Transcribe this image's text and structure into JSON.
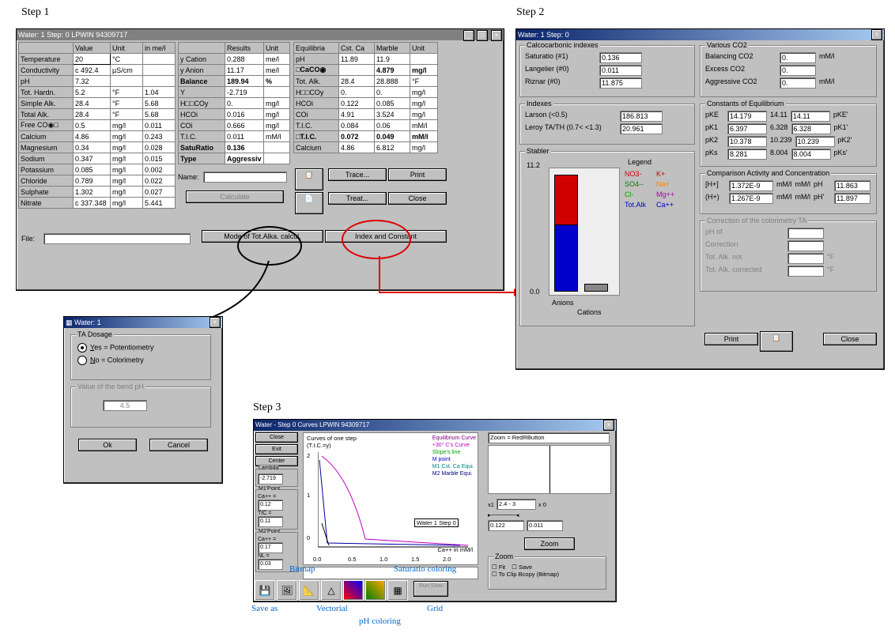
{
  "steps": {
    "s1": "Step 1",
    "s2": "Step 2",
    "s3": "Step 3"
  },
  "win1": {
    "title": "Water:  1 Step:  0        LPWIN 94309717",
    "hdr1": {
      "c1": "",
      "c2": "Value",
      "c3": "Unit",
      "c4": "in me/l"
    },
    "rows1": [
      {
        "n": "Temperature",
        "v": "20",
        "u": "°C",
        "m": ""
      },
      {
        "n": "Conductivity",
        "v": "c 492.4",
        "u": "µS/cm",
        "m": ""
      },
      {
        "n": "pH",
        "v": "7.32",
        "u": "",
        "m": ""
      },
      {
        "n": "Tot. Hardn.",
        "v": "5.2",
        "u": "°F",
        "m": "1.04"
      },
      {
        "n": "Simple Alk.",
        "v": "28.4",
        "u": "°F",
        "m": "5.68"
      },
      {
        "n": "Total Alk.",
        "v": "28.4",
        "u": "°F",
        "m": "5.68"
      },
      {
        "n": "Free CO◉□",
        "v": "0.5",
        "u": "mg/l",
        "m": "0.011"
      },
      {
        "n": "Calcium",
        "v": "4.86",
        "u": "mg/l",
        "m": "0.243"
      },
      {
        "n": "Magnesium",
        "v": "0.34",
        "u": "mg/l",
        "m": "0.028"
      },
      {
        "n": "Sodium",
        "v": "0.347",
        "u": "mg/l",
        "m": "0.015"
      },
      {
        "n": "Potassium",
        "v": "0.085",
        "u": "mg/l",
        "m": "0.002"
      },
      {
        "n": "Chloride",
        "v": "0.789",
        "u": "mg/l",
        "m": "0.022"
      },
      {
        "n": "Sulphate",
        "v": "1.302",
        "u": "mg/l",
        "m": "0.027"
      },
      {
        "n": "Nitrate",
        "v": "c 337.348",
        "u": "mg/l",
        "m": "5.441"
      }
    ],
    "hdr2": {
      "c1": "",
      "c2": "Results",
      "c3": "Unit"
    },
    "rows2": [
      {
        "n": "y Cation",
        "v": "0.288",
        "u": "me/l",
        "b": false
      },
      {
        "n": "y Anion",
        "v": "11.17",
        "u": "me/l",
        "b": false
      },
      {
        "n": "Balance",
        "v": "189.94",
        "u": "%",
        "b": true
      },
      {
        "n": "Y",
        "v": "-2.719",
        "u": "",
        "b": false
      },
      {
        "n": "H□□COy",
        "v": "0.",
        "u": "mg/l",
        "b": false
      },
      {
        "n": "HCOi",
        "v": "0.016",
        "u": "mg/l",
        "b": false
      },
      {
        "n": "COi",
        "v": "0.666",
        "u": "mg/l",
        "b": false
      },
      {
        "n": "T.I.C.",
        "v": "0.011",
        "u": "mM/l",
        "b": false
      },
      {
        "n": "SatuRatio",
        "v": "0.136",
        "u": "",
        "b": true
      },
      {
        "n": "Type",
        "v": "Aggressiv",
        "u": "",
        "b": true
      }
    ],
    "hdr3": {
      "c1": "Equilibria",
      "c2": "Cst. Ca",
      "c3": "Marble",
      "c4": "Unit"
    },
    "rows3": [
      {
        "n": "pH",
        "a": "11.89",
        "b": "11.9",
        "u": "",
        "bold": false
      },
      {
        "n": "□CaCO◉",
        "a": "",
        "b": "4.879",
        "u": "mg/l",
        "bold": true
      },
      {
        "n": "Tot. Alk.",
        "a": "28.4",
        "b": "28.888",
        "u": "°F",
        "bold": false
      },
      {
        "n": "H□□COy",
        "a": "0.",
        "b": "0.",
        "u": "mg/l",
        "bold": false
      },
      {
        "n": "HCOi",
        "a": "0.122",
        "b": "0.085",
        "u": "mg/l",
        "bold": false
      },
      {
        "n": "COi",
        "a": "4.91",
        "b": "3.524",
        "u": "mg/l",
        "bold": false
      },
      {
        "n": "T.I.C.",
        "a": "0.084",
        "b": "0.06",
        "u": "mM/l",
        "bold": false
      },
      {
        "n": "□T.I.C.",
        "a": "0.072",
        "b": "0.049",
        "u": "mM/l",
        "bold": true
      },
      {
        "n": "Calcium",
        "a": "4.86",
        "b": "6.812",
        "u": "mg/l",
        "bold": false
      }
    ],
    "name_label": "Name:",
    "file_label": "File:",
    "btns": {
      "calc": "Calculate",
      "mode": "Mode of Tot.Alka. calcul.",
      "idx": "Index and Constant",
      "trace": "Trace...",
      "treat": "Treat...",
      "print": "Print",
      "close": "Close"
    }
  },
  "ta": {
    "title": "Water:  1",
    "group": "TA Dosage",
    "yes": "Yes = Potentiometry",
    "no": "No = Colorimetry",
    "group2": "Value of the bend pH",
    "val": "4.5",
    "ok": "Ok",
    "cancel": "Cancel"
  },
  "win2": {
    "title": "Water:  1 Step:  0",
    "g_calc": "Calcocarbonic indexes",
    "calc": [
      [
        "Saturatio (#1)",
        "0.136"
      ],
      [
        "Langelier (#0)",
        "0.011"
      ],
      [
        "Riznar (#0)",
        "11.875"
      ]
    ],
    "g_idx": "Indexes",
    "idx": [
      [
        "Larson (<0.5)",
        "186.813"
      ],
      [
        "Leroy TA/TH (0.7< <1.3)",
        "20.961"
      ]
    ],
    "g_stab": "Stabler",
    "stab_legend": "Legend",
    "stab_items": [
      [
        "NO3-",
        "#cc0000"
      ],
      [
        "SO4--",
        "#008000"
      ],
      [
        "Cl-",
        "#00aa00"
      ],
      [
        "Tot.Alk",
        "#0000cc"
      ],
      [
        "K+",
        "#cc0000"
      ],
      [
        "Na+",
        "#ee8800"
      ],
      [
        "Mg++",
        "#aa00aa"
      ],
      [
        "Ca++",
        "#0000cc"
      ]
    ],
    "stab_y_top": "11.2",
    "stab_y_bot": "0.0",
    "stab_x1": "Anions",
    "stab_x2": "Cations",
    "g_co2": "Various CO2",
    "co2": [
      [
        "Balancing CO2",
        "0.",
        "mM/l"
      ],
      [
        "Excess CO2",
        "0.",
        ""
      ],
      [
        "Aggressive CO2",
        "0.",
        "mM/l"
      ]
    ],
    "g_keq": "Constants of Equilibrium",
    "keq": [
      [
        "pKE",
        "14.179",
        "14.11",
        "pKE'"
      ],
      [
        "pK1",
        "6.397",
        "6.328",
        "pK1'"
      ],
      [
        "pK2",
        "10.378",
        "10.239",
        "pK2'"
      ],
      [
        "pKs",
        "8.281",
        "8.004",
        "pKs'"
      ]
    ],
    "g_cmp": "Comparison Activity and Concentration",
    "cmp": [
      [
        "[H+]",
        "1.372E-9",
        "mM/l",
        "pH",
        "11.863"
      ],
      [
        "(H+)",
        "1.267E-9",
        "mM/l",
        "pH'",
        "11.897"
      ]
    ],
    "g_corr": "Correction of the colorimetry TA",
    "corr": [
      "pH of",
      "Correction",
      "Tot. Alk. not",
      "Tot. Alk. corrected"
    ],
    "corr_u": [
      "",
      "",
      "°F",
      "°F"
    ],
    "print": "Print",
    "close": "Close"
  },
  "win3": {
    "title": "Water - Step 0 Curves      LPWIN 94309717",
    "btns": [
      "Close",
      "Exit",
      "Center"
    ],
    "lambda": "Lambda",
    "lambda_v": "-2.719",
    "m1": "M1'Point",
    "m1v": "Ca++ =",
    "m1v2": "0.12",
    "tic": "TIC =",
    "ticv": "0.11",
    "m2": "M2'Point",
    "m2v": "Ca++ =",
    "m2v2": "0.17",
    "nl": "NL =",
    "nlv": "0.03",
    "graph_title": "Curves of one step",
    "graph_sub": "(T.I.C.=y)",
    "legend": [
      "Equilibrium Curve",
      "+30° C's Curve",
      "Slope's line",
      "M point",
      "M1 Cst. Ca Equi.",
      "M2 Marble Equi."
    ],
    "series_label": "Water 1 Step 0",
    "xaxis": "Ca++ in mM/l",
    "xticks": [
      "0.0",
      "0.5",
      "1.0",
      "1.5",
      "2.0"
    ],
    "yticks": [
      "0",
      "1",
      "2"
    ],
    "zoom": "Zoom = RedRButton",
    "x1": "x1",
    "x1v": "2.4 - 3",
    "x0l": "x 0",
    "bl": "0.122",
    "br": "0.011",
    "zoombtn": "Zoom",
    "zoomgroup": "Zoom",
    "fit": "Fit",
    "save": "Save",
    "clip": "To Clip Bcopy (Bitmap)",
    "run": "Run Slow"
  },
  "anno": {
    "bitmap": "Bitmap",
    "save": "Save as",
    "vect": "Vectorial",
    "phc": "pH coloring",
    "satc": "Saturatio coloring",
    "grid": "Grid"
  },
  "chart_data": {
    "type": "bar",
    "title": "Stabler",
    "categories": [
      "Anions",
      "Cations"
    ],
    "series": [
      {
        "name": "NO3-",
        "values": [
          5.1,
          0
        ]
      },
      {
        "name": "Tot.Alk",
        "values": [
          6.0,
          0
        ]
      },
      {
        "name": "Ca++",
        "values": [
          0,
          0.3
        ]
      }
    ],
    "ylim": [
      0,
      11.2
    ]
  }
}
